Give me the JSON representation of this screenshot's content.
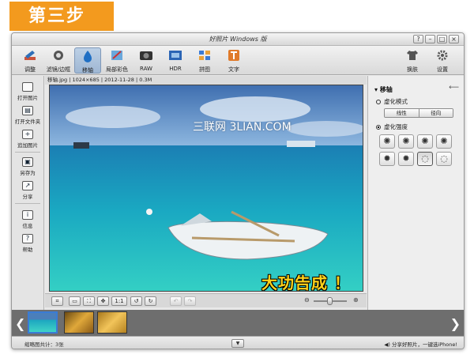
{
  "banner": {
    "label": "第三步"
  },
  "window": {
    "title": "好照片 Windows 版",
    "controls": {
      "help": "?",
      "minimize": "–",
      "maximize": "□",
      "close": "×"
    }
  },
  "toolbar": {
    "tools": [
      {
        "label": "调整",
        "icon": "pencil-icon"
      },
      {
        "label": "滤镜/边框",
        "icon": "filter-icon"
      },
      {
        "label": "移轴",
        "icon": "tilt-shift-icon",
        "active": true
      },
      {
        "label": "局部彩色",
        "icon": "brush-icon"
      },
      {
        "label": "RAW",
        "icon": "raw-icon"
      },
      {
        "label": "HDR",
        "icon": "hdr-icon"
      },
      {
        "label": "拼图",
        "icon": "collage-icon"
      },
      {
        "label": "文字",
        "icon": "text-icon"
      }
    ],
    "right": [
      {
        "label": "换肤",
        "icon": "shirt-icon"
      },
      {
        "label": "设置",
        "icon": "gear-icon"
      }
    ]
  },
  "sidebar": {
    "items": [
      {
        "label": "打开图片"
      },
      {
        "label": "打开文件夹"
      },
      {
        "label": "追加图片"
      },
      {
        "label": "另存为"
      },
      {
        "label": "分享"
      },
      {
        "label": "信息"
      },
      {
        "label": "帮助"
      }
    ]
  },
  "infobar": {
    "text": "移轴.jpg | 1024×685 | 2012-11-28 | 0.3M"
  },
  "photo": {
    "watermark": "三联网 3LIAN.COM",
    "caption": "大功告成 ！"
  },
  "bottom_tools": {
    "one_to_one": "1:1"
  },
  "panel": {
    "title": "移轴",
    "blur_mode_label": "虚化模式",
    "modes": [
      "线性",
      "径向"
    ],
    "blur_strength_label": "虚化强度"
  },
  "status": {
    "left": "缩略图共计：3张",
    "right": "分享好照片，一键选iPhone!"
  },
  "colors": {
    "banner": "#f39a1e",
    "caption": "#ffd21a",
    "active_tool": "#9fb7d3"
  }
}
